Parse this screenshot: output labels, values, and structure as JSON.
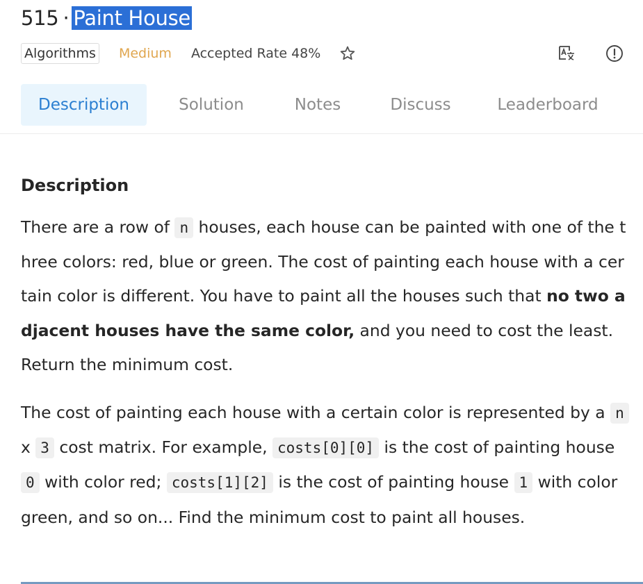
{
  "problem": {
    "number": "515",
    "separator": "·",
    "title": "Paint House"
  },
  "meta": {
    "tag": "Algorithms",
    "difficulty": "Medium",
    "accepted_rate": "Accepted Rate 48%"
  },
  "icons": {
    "star": "star-icon",
    "translate": "translate-icon",
    "info": "info-icon"
  },
  "tabs": [
    {
      "label": "Description"
    },
    {
      "label": "Solution"
    },
    {
      "label": "Notes"
    },
    {
      "label": "Discuss"
    },
    {
      "label": "Leaderboard"
    }
  ],
  "description": {
    "heading": "Description",
    "p1": {
      "t1": "There are a row of ",
      "c1": "n",
      "t2": " houses, each house can be painted with one of the three colors: red, blue or green. The cost of painting each house with a certain color is different. You have to paint all the houses such that ",
      "bold": "no two adjacent houses have the same color,",
      "t3": " and you need to cost the least. Return the minimum cost."
    },
    "p2": {
      "t1": "The cost of painting each house with a certain color is represented by a ",
      "c1": "n",
      "t2": " x ",
      "c2": "3",
      "t3": " cost matrix. For example, ",
      "c3": "costs[0][0]",
      "t4": " is the cost of painting house ",
      "c4": "0",
      "t5": " with color red; ",
      "c5": "costs[1][2]",
      "t6": " is the cost of painting house ",
      "c6": "1",
      "t7": " with color green, and so on... Find the minimum cost to paint all houses."
    }
  },
  "colors": {
    "accent": "#2b7fd1",
    "active_tab_bg": "#e9f5fd",
    "medium": "#e0a64f",
    "selection": "#2b6fd6",
    "code_bg": "#f0f0f0"
  }
}
